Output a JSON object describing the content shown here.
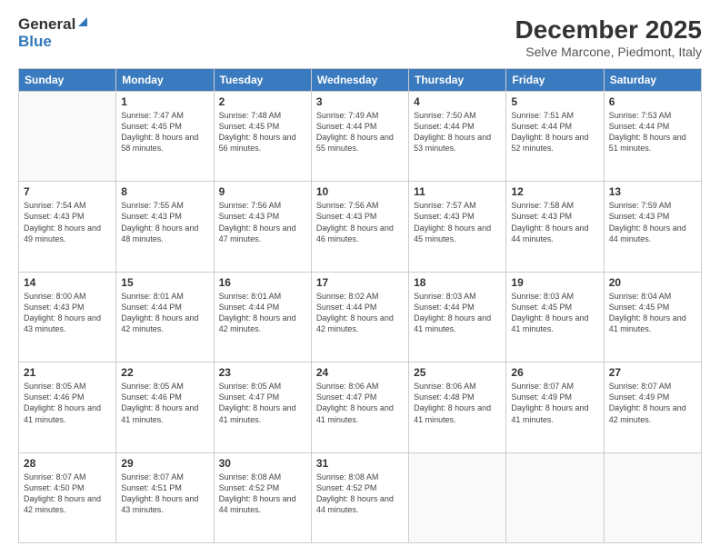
{
  "header": {
    "logo_general": "General",
    "logo_blue": "Blue",
    "month_title": "December 2025",
    "subtitle": "Selve Marcone, Piedmont, Italy"
  },
  "columns": [
    "Sunday",
    "Monday",
    "Tuesday",
    "Wednesday",
    "Thursday",
    "Friday",
    "Saturday"
  ],
  "weeks": [
    [
      {
        "day": "",
        "sunrise": "",
        "sunset": "",
        "daylight": ""
      },
      {
        "day": "1",
        "sunrise": "Sunrise: 7:47 AM",
        "sunset": "Sunset: 4:45 PM",
        "daylight": "Daylight: 8 hours and 58 minutes."
      },
      {
        "day": "2",
        "sunrise": "Sunrise: 7:48 AM",
        "sunset": "Sunset: 4:45 PM",
        "daylight": "Daylight: 8 hours and 56 minutes."
      },
      {
        "day": "3",
        "sunrise": "Sunrise: 7:49 AM",
        "sunset": "Sunset: 4:44 PM",
        "daylight": "Daylight: 8 hours and 55 minutes."
      },
      {
        "day": "4",
        "sunrise": "Sunrise: 7:50 AM",
        "sunset": "Sunset: 4:44 PM",
        "daylight": "Daylight: 8 hours and 53 minutes."
      },
      {
        "day": "5",
        "sunrise": "Sunrise: 7:51 AM",
        "sunset": "Sunset: 4:44 PM",
        "daylight": "Daylight: 8 hours and 52 minutes."
      },
      {
        "day": "6",
        "sunrise": "Sunrise: 7:53 AM",
        "sunset": "Sunset: 4:44 PM",
        "daylight": "Daylight: 8 hours and 51 minutes."
      }
    ],
    [
      {
        "day": "7",
        "sunrise": "Sunrise: 7:54 AM",
        "sunset": "Sunset: 4:43 PM",
        "daylight": "Daylight: 8 hours and 49 minutes."
      },
      {
        "day": "8",
        "sunrise": "Sunrise: 7:55 AM",
        "sunset": "Sunset: 4:43 PM",
        "daylight": "Daylight: 8 hours and 48 minutes."
      },
      {
        "day": "9",
        "sunrise": "Sunrise: 7:56 AM",
        "sunset": "Sunset: 4:43 PM",
        "daylight": "Daylight: 8 hours and 47 minutes."
      },
      {
        "day": "10",
        "sunrise": "Sunrise: 7:56 AM",
        "sunset": "Sunset: 4:43 PM",
        "daylight": "Daylight: 8 hours and 46 minutes."
      },
      {
        "day": "11",
        "sunrise": "Sunrise: 7:57 AM",
        "sunset": "Sunset: 4:43 PM",
        "daylight": "Daylight: 8 hours and 45 minutes."
      },
      {
        "day": "12",
        "sunrise": "Sunrise: 7:58 AM",
        "sunset": "Sunset: 4:43 PM",
        "daylight": "Daylight: 8 hours and 44 minutes."
      },
      {
        "day": "13",
        "sunrise": "Sunrise: 7:59 AM",
        "sunset": "Sunset: 4:43 PM",
        "daylight": "Daylight: 8 hours and 44 minutes."
      }
    ],
    [
      {
        "day": "14",
        "sunrise": "Sunrise: 8:00 AM",
        "sunset": "Sunset: 4:43 PM",
        "daylight": "Daylight: 8 hours and 43 minutes."
      },
      {
        "day": "15",
        "sunrise": "Sunrise: 8:01 AM",
        "sunset": "Sunset: 4:44 PM",
        "daylight": "Daylight: 8 hours and 42 minutes."
      },
      {
        "day": "16",
        "sunrise": "Sunrise: 8:01 AM",
        "sunset": "Sunset: 4:44 PM",
        "daylight": "Daylight: 8 hours and 42 minutes."
      },
      {
        "day": "17",
        "sunrise": "Sunrise: 8:02 AM",
        "sunset": "Sunset: 4:44 PM",
        "daylight": "Daylight: 8 hours and 42 minutes."
      },
      {
        "day": "18",
        "sunrise": "Sunrise: 8:03 AM",
        "sunset": "Sunset: 4:44 PM",
        "daylight": "Daylight: 8 hours and 41 minutes."
      },
      {
        "day": "19",
        "sunrise": "Sunrise: 8:03 AM",
        "sunset": "Sunset: 4:45 PM",
        "daylight": "Daylight: 8 hours and 41 minutes."
      },
      {
        "day": "20",
        "sunrise": "Sunrise: 8:04 AM",
        "sunset": "Sunset: 4:45 PM",
        "daylight": "Daylight: 8 hours and 41 minutes."
      }
    ],
    [
      {
        "day": "21",
        "sunrise": "Sunrise: 8:05 AM",
        "sunset": "Sunset: 4:46 PM",
        "daylight": "Daylight: 8 hours and 41 minutes."
      },
      {
        "day": "22",
        "sunrise": "Sunrise: 8:05 AM",
        "sunset": "Sunset: 4:46 PM",
        "daylight": "Daylight: 8 hours and 41 minutes."
      },
      {
        "day": "23",
        "sunrise": "Sunrise: 8:05 AM",
        "sunset": "Sunset: 4:47 PM",
        "daylight": "Daylight: 8 hours and 41 minutes."
      },
      {
        "day": "24",
        "sunrise": "Sunrise: 8:06 AM",
        "sunset": "Sunset: 4:47 PM",
        "daylight": "Daylight: 8 hours and 41 minutes."
      },
      {
        "day": "25",
        "sunrise": "Sunrise: 8:06 AM",
        "sunset": "Sunset: 4:48 PM",
        "daylight": "Daylight: 8 hours and 41 minutes."
      },
      {
        "day": "26",
        "sunrise": "Sunrise: 8:07 AM",
        "sunset": "Sunset: 4:49 PM",
        "daylight": "Daylight: 8 hours and 41 minutes."
      },
      {
        "day": "27",
        "sunrise": "Sunrise: 8:07 AM",
        "sunset": "Sunset: 4:49 PM",
        "daylight": "Daylight: 8 hours and 42 minutes."
      }
    ],
    [
      {
        "day": "28",
        "sunrise": "Sunrise: 8:07 AM",
        "sunset": "Sunset: 4:50 PM",
        "daylight": "Daylight: 8 hours and 42 minutes."
      },
      {
        "day": "29",
        "sunrise": "Sunrise: 8:07 AM",
        "sunset": "Sunset: 4:51 PM",
        "daylight": "Daylight: 8 hours and 43 minutes."
      },
      {
        "day": "30",
        "sunrise": "Sunrise: 8:08 AM",
        "sunset": "Sunset: 4:52 PM",
        "daylight": "Daylight: 8 hours and 44 minutes."
      },
      {
        "day": "31",
        "sunrise": "Sunrise: 8:08 AM",
        "sunset": "Sunset: 4:52 PM",
        "daylight": "Daylight: 8 hours and 44 minutes."
      },
      {
        "day": "",
        "sunrise": "",
        "sunset": "",
        "daylight": ""
      },
      {
        "day": "",
        "sunrise": "",
        "sunset": "",
        "daylight": ""
      },
      {
        "day": "",
        "sunrise": "",
        "sunset": "",
        "daylight": ""
      }
    ]
  ]
}
